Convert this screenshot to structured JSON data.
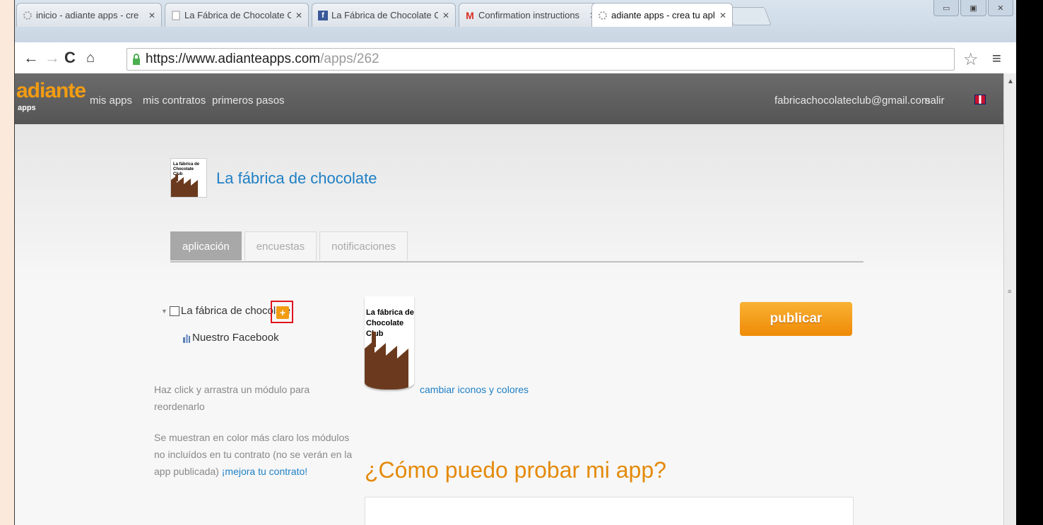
{
  "browser": {
    "tabs": [
      {
        "label": "inicio - adiante apps - cre",
        "icon": "adiante-favicon"
      },
      {
        "label": "La Fábrica de Chocolate C",
        "icon": "page-icon"
      },
      {
        "label": "La Fábrica de Chocolate C",
        "icon": "facebook-icon"
      },
      {
        "label": "Confirmation instructions",
        "icon": "gmail-icon"
      },
      {
        "label": "adiante apps - crea tu apl",
        "icon": "adiante-favicon"
      }
    ],
    "url_host": "https://www.adianteapps.com",
    "url_path": "/apps/262"
  },
  "header": {
    "logo": "adiante",
    "logo_sub": "apps",
    "nav": [
      "mis apps",
      "mis contratos",
      "primeros pasos"
    ],
    "email": "fabricachocolateclub@gmail.com",
    "logout": "salir"
  },
  "app": {
    "title": "La fábrica de chocolate",
    "icon_text": [
      "La fábrica de",
      "Chocolate",
      "Club"
    ]
  },
  "tabs": [
    "aplicación",
    "encuestas",
    "notificaciones"
  ],
  "tree": {
    "root": "La fábrica de chocolate",
    "child": "Nuestro Facebook",
    "add_symbol": "+"
  },
  "help": {
    "drag": "Haz click y arrastra un módulo para reordenarlo",
    "lighter": "Se muestran en color más claro los módulos no incluídos en tu contrato (no se verán en la app publicada)",
    "upgrade_link": "¡mejora tu contrato!"
  },
  "main": {
    "change_icons": "cambiar iconos y colores",
    "publish": "publicar",
    "how_heading": "¿Cómo puedo probar mi app?"
  },
  "colors": {
    "accent": "#f39c12",
    "link": "#1e7fc4",
    "highlight": "#e0141f"
  }
}
